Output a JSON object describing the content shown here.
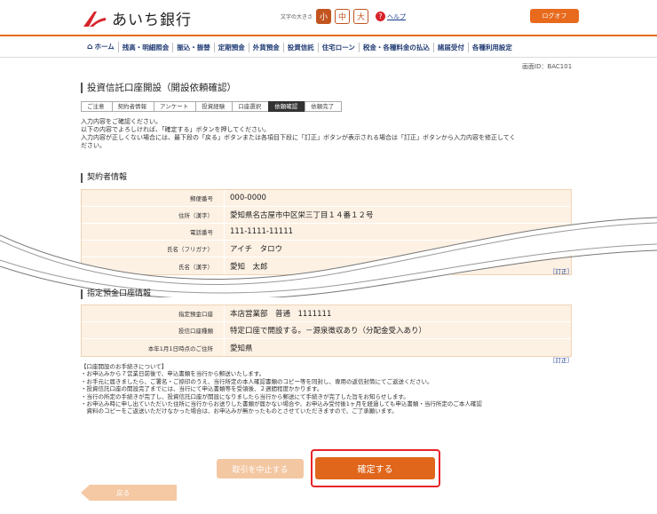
{
  "header": {
    "bank_name": "あいち銀行",
    "font_size_label": "文字の大きさ",
    "font_sizes": [
      "小",
      "中",
      "大"
    ],
    "help_label": "ヘルプ",
    "logout_label": "ログオフ"
  },
  "nav": {
    "items": [
      "ホーム",
      "残高・明細照会",
      "振込・振替",
      "定期預金",
      "外貨預金",
      "投資信託",
      "住宅ローン",
      "税金・各種料金の払込",
      "諸届受付",
      "各種利用設定"
    ]
  },
  "screen_id": "画面ID：BAC101",
  "page_title": "投資信託口座開設（開設依頼確認）",
  "steps": [
    "ご注意",
    "契約者情報",
    "アンケート",
    "投資経験",
    "口座選択",
    "依頼確認",
    "依頼完了"
  ],
  "intro": {
    "line1": "入力内容をご確認ください。",
    "line2": "以下の内容でよろしければ、「確定する」ボタンを押してください。",
    "line3": "入力内容が正しくない場合には、最下段の「戻る」ボタンまたは各項目下段に「訂正」ボタンが表示される場合は「訂正」ボタンから入力内容を修正してく",
    "line4": "ださい。"
  },
  "contractor": {
    "title": "契約者情報",
    "rows": [
      {
        "label": "郵便番号",
        "value": "000-0000"
      },
      {
        "label": "住所（漢字）",
        "value": "愛知県名古屋市中区栄三丁目１４番１２号"
      },
      {
        "label": "電話番号",
        "value": "111-1111-11111"
      },
      {
        "label": "氏名（フリガナ）",
        "value": "アイチ　タロウ"
      },
      {
        "label": "氏名（漢字）",
        "value": "愛知　太郎"
      }
    ],
    "fix_label": "［訂正］"
  },
  "account": {
    "title": "指定預金口座情報",
    "rows": [
      {
        "label": "指定預金口座",
        "value": "本店営業部　普通　1111111"
      },
      {
        "label": "投信口座種類",
        "value": "特定口座で開設する。－源泉徴収あり（分配金受入あり）"
      },
      {
        "label": "本年1月1日時点のご住所",
        "value": "愛知県"
      }
    ],
    "fix_label": "［訂正］"
  },
  "notes": {
    "title": "【口座開設のお手続きについて】",
    "items": [
      "・お申込みから７営業日前後で、申込書類を当行から郵送いたします。",
      "・お手元に届きましたら、ご署名・ご捺印のうえ、当行所定の本人確認書類のコピー等を同封し、専用の返信封筒にてご返送ください。",
      "・投資信託口座の開設完了までには、当行にて申込書類等を受領後、２週間程度かかります。",
      "・当行の所定の手続きが完了し、投資信託口座が開設になりましたら当行から郵送にて手続きが完了した旨をお知らせします。",
      "・お申込み時に申し出ていただいた住所に当行からお送りした書類が届かない場合や、お申込み受付後1ヶ月を経過しても申込書類・当行所定のご本人確認",
      "　資料のコピーをご返送いただけなかった場合は、お申込みが無かったものとさせていただきますので、ご了承願います。"
    ]
  },
  "buttons": {
    "cancel": "取引を中止する",
    "confirm": "確定する",
    "back": "戻る"
  },
  "colors": {
    "brand_orange": "#e86a1d",
    "highlight_red": "#e8242a"
  }
}
